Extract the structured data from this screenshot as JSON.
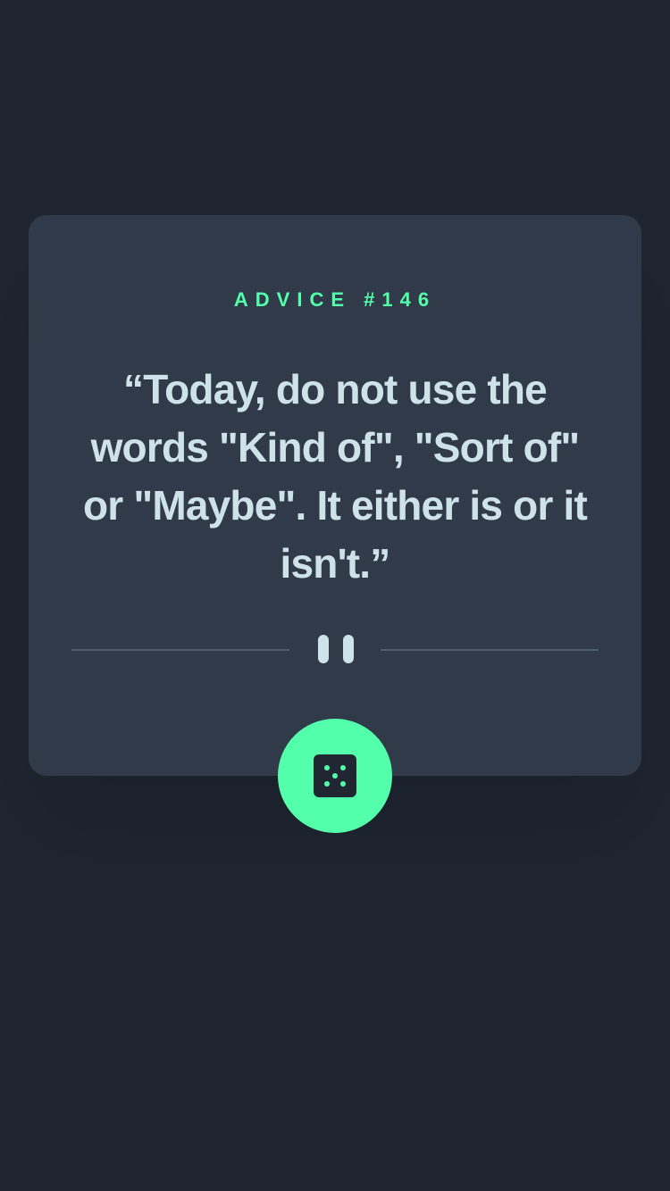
{
  "advice": {
    "label": "ADVICE #146",
    "text": "“Today, do not use the words \"Kind of\", \"Sort of\" or \"Maybe\". It either is or it isn't.”"
  },
  "divider": {
    "icon": "pause-icon"
  },
  "button": {
    "icon": "dice-icon"
  },
  "colors": {
    "background": "#1f2631",
    "card": "#313a48",
    "accent": "#53ffaa",
    "text": "#cee3e9",
    "divider": "#4f5d74"
  }
}
